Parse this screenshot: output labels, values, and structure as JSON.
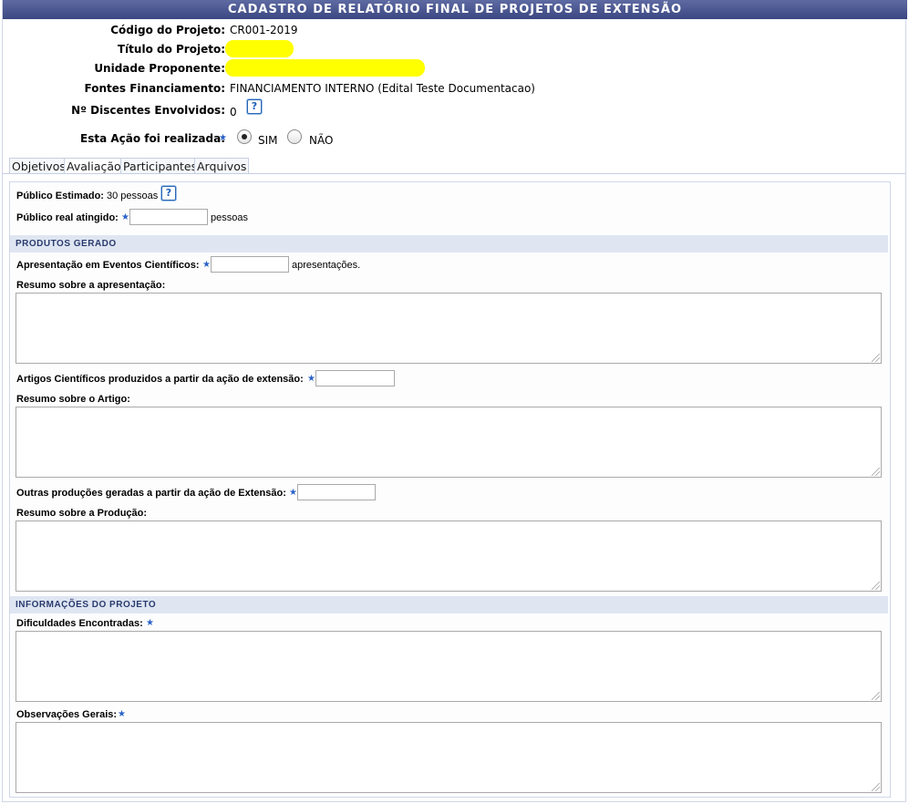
{
  "page_title": "CADASTRO DE RELATÓRIO FINAL DE PROJETOS DE EXTENSÃO",
  "header": {
    "codigo_label": "Código do Projeto:",
    "codigo_value": "CR001-2019",
    "titulo_label": "Título do Projeto:",
    "unidade_label": "Unidade Proponente:",
    "fontes_label": "Fontes Financiamento:",
    "fontes_value": "FINANCIAMENTO INTERNO (Edital Teste Documentacao)",
    "discentes_label": "Nº Discentes Envolvidos:",
    "discentes_value": "0",
    "acao_label": "Esta Ação foi realizada:",
    "sim_label": "SIM",
    "nao_label": "NÃO",
    "acao_selected": "SIM"
  },
  "tabs": [
    "Objetivos",
    "Avaliação",
    "Participantes",
    "Arquivos"
  ],
  "active_tab": "Avaliação",
  "help_glyph": "?",
  "required_glyph": "★",
  "form": {
    "publico_estimado_label": "Público Estimado:",
    "publico_estimado_value": "30 pessoas",
    "publico_real_label": "Público real atingido:",
    "publico_real_unit": "pessoas",
    "section_produtos": "PRODUTOS GERADO",
    "apresentacao_label": "Apresentação em Eventos Científicos:",
    "apresentacao_unit": "apresentações.",
    "resumo_apresentacao_label": "Resumo sobre a apresentação:",
    "artigos_label": "Artigos Científicos produzidos a partir da ação de extensão:",
    "resumo_artigo_label": "Resumo sobre o Artigo:",
    "outras_label": "Outras produções geradas a partir da ação de Extensão:",
    "resumo_producao_label": "Resumo sobre a Produção:",
    "section_informacoes": "INFORMAÇÕES DO PROJETO",
    "dificuldades_label": "Dificuldades Encontradas:",
    "observacoes_label": "Observações Gerais:"
  },
  "colors": {
    "title_bar": "#3b4781",
    "section_bg": "#dfe6f2",
    "required_star": "#2a62c8",
    "redaction": "#ffff00"
  }
}
